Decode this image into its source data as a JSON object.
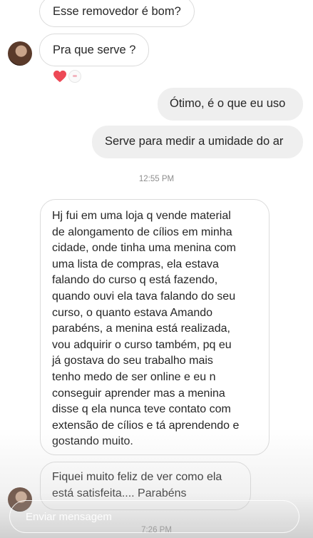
{
  "messages": [
    {
      "id": "m1",
      "direction": "incoming",
      "text": "Esse removedor é bom?"
    },
    {
      "id": "m2",
      "direction": "incoming",
      "text": "Pra que serve ?",
      "reactions": [
        "heart-icon"
      ]
    },
    {
      "id": "m3",
      "direction": "outgoing",
      "text": "Ótimo, é o que eu uso"
    },
    {
      "id": "m4",
      "direction": "outgoing",
      "text": "Serve para medir a umidade do ar"
    },
    {
      "id": "m5",
      "direction": "incoming",
      "text": "Hj fui em uma loja q vende material\nde alongamento de cílios em minha\ncidade, onde tinha uma menina com\numa lista de compras, ela estava\nfalando do curso q está fazendo,\nquando ouvi ela tava falando do seu\ncurso, o quanto estava Amando\nparabéns, a menina está realizada,\nvou adquirir o curso também, pq eu\njá gostava do seu trabalho mais\ntenho medo de ser online e eu n\nconseguir aprender mas a menina\ndisse q ela nunca teve contato com\nextensão de cílios e tá aprendendo e\ngostando muito."
    },
    {
      "id": "m6",
      "direction": "incoming",
      "text": "Fiquei muito feliz de ver como ela\nestá satisfeita.... Parabéns"
    }
  ],
  "timestamps": {
    "first": "12:55 PM",
    "second": "7:26 PM"
  },
  "composer": {
    "placeholder": "Enviar mensagem"
  },
  "colors": {
    "incoming_border": "#dbdbdb",
    "outgoing_bg": "#efefef",
    "heart": "#ed4956",
    "timestamp": "#8e8e8e"
  }
}
